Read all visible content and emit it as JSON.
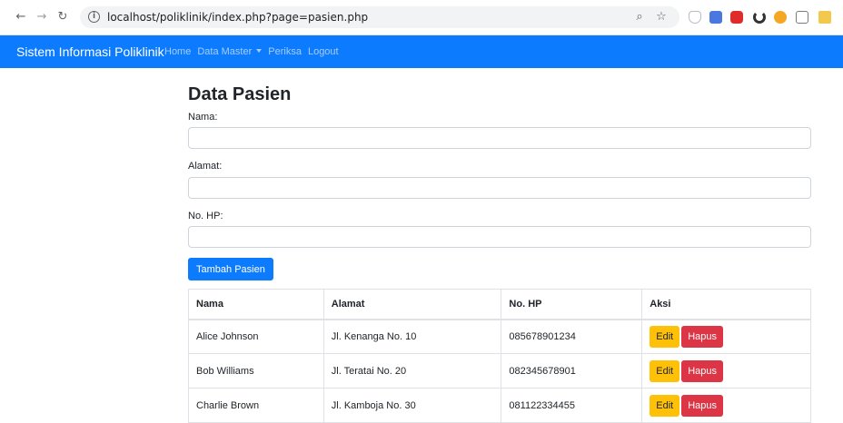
{
  "browser": {
    "url": "localhost/poliklinik/index.php?page=pasien.php",
    "icons": [
      "back-icon",
      "forward-icon",
      "reload-icon",
      "info-icon",
      "zoom-icon",
      "star-icon"
    ]
  },
  "navbar": {
    "brand": "Sistem Informasi Poliklinik",
    "links": {
      "home": "Home",
      "data_master": "Data Master",
      "periksa": "Periksa",
      "logout": "Logout"
    },
    "color": "#0d7bfd"
  },
  "form": {
    "title": "Data Pasien",
    "nama_label": "Nama:",
    "alamat_label": "Alamat:",
    "hp_label": "No. HP:",
    "nama_value": "",
    "alamat_value": "",
    "hp_value": "",
    "submit_label": "Tambah Pasien"
  },
  "table": {
    "headers": [
      "Nama",
      "Alamat",
      "No. HP",
      "Aksi"
    ],
    "rows": [
      {
        "nama": "Alice Johnson",
        "alamat": "Jl. Kenanga No. 10",
        "hp": "085678901234"
      },
      {
        "nama": "Bob Williams",
        "alamat": "Jl. Teratai No. 20",
        "hp": "082345678901"
      },
      {
        "nama": "Charlie Brown",
        "alamat": "Jl. Kamboja No. 30",
        "hp": "081122334455"
      }
    ],
    "edit_label": "Edit",
    "delete_label": "Hapus"
  },
  "colors": {
    "primary": "#0d7bfd",
    "warning": "#ffc107",
    "danger": "#dc3545"
  }
}
